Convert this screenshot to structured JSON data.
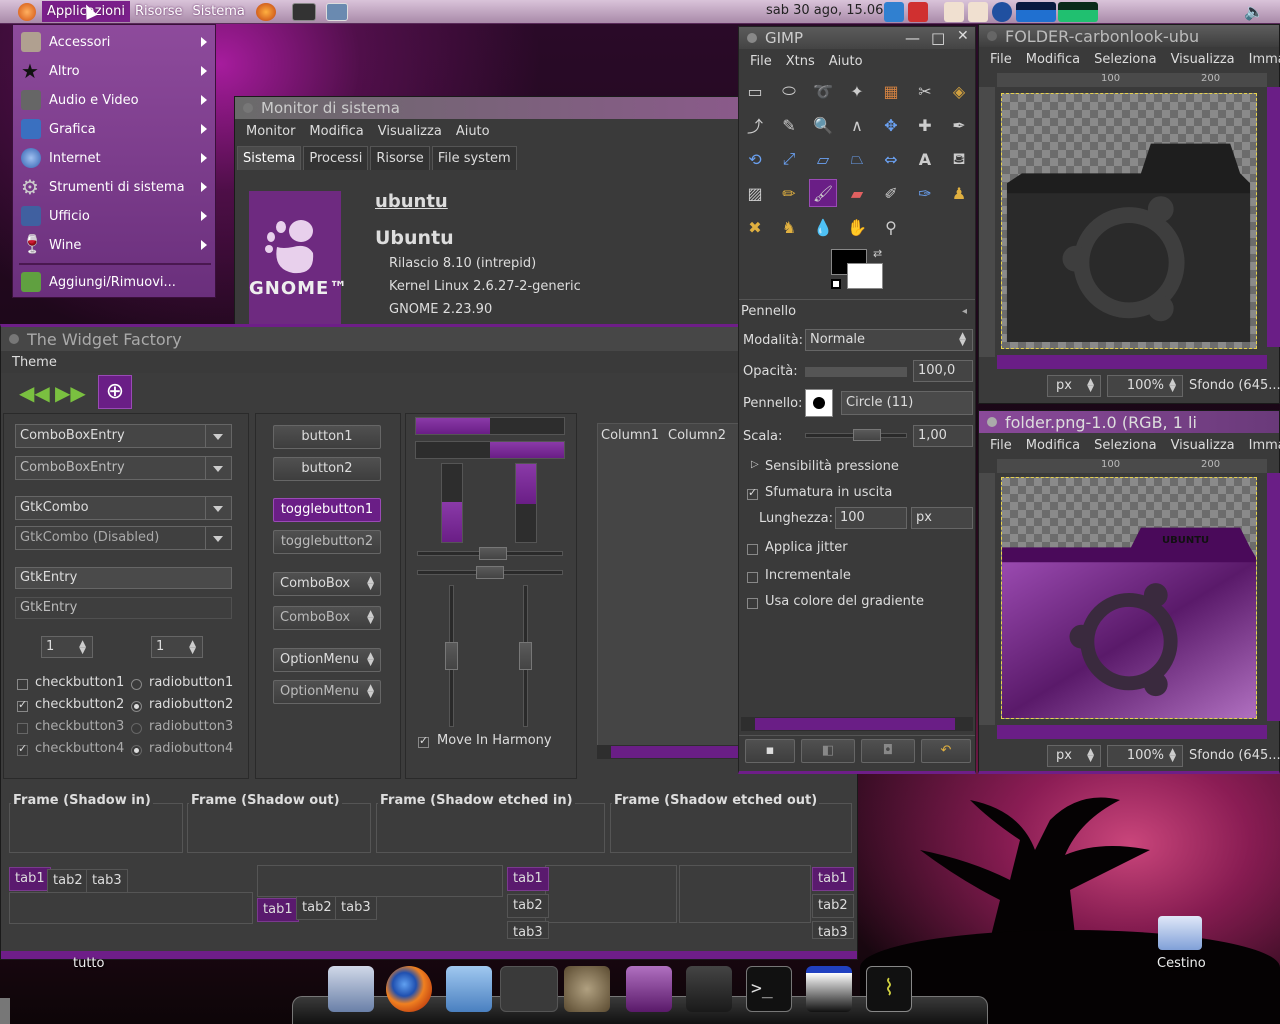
{
  "panel": {
    "menus": [
      "Applicazioni",
      "Risorse",
      "Sistema"
    ],
    "clock": "sab 30 ago, 15.06"
  },
  "app_menu": {
    "items": [
      {
        "label": "Accessori",
        "icon": "accessories-icon",
        "color": "#b0a090"
      },
      {
        "label": "Altro",
        "icon": "star-icon",
        "color": "#222222"
      },
      {
        "label": "Audio e Video",
        "icon": "film-icon",
        "color": "#666666"
      },
      {
        "label": "Grafica",
        "icon": "graphics-icon",
        "color": "#3a70c0"
      },
      {
        "label": "Internet",
        "icon": "globe-icon",
        "color": "#4a7ad0"
      },
      {
        "label": "Strumenti di sistema",
        "icon": "gear-icon",
        "color": "#888888"
      },
      {
        "label": "Ufficio",
        "icon": "office-icon",
        "color": "#4060a0"
      },
      {
        "label": "Wine",
        "icon": "wine-icon",
        "color": "#b03030"
      }
    ],
    "add_remove": "Aggiungi/Rimuovi..."
  },
  "sysmon": {
    "title": "Monitor di sistema",
    "menus": [
      "Monitor",
      "Modifica",
      "Visualizza",
      "Aiuto"
    ],
    "tabs": [
      "Sistema",
      "Processi",
      "Risorse",
      "File system"
    ],
    "hostname": "ubuntu",
    "distro": "Ubuntu",
    "release": "Rilascio 8.10 (intrepid)",
    "kernel": "Kernel Linux 2.6.27-2-generic",
    "gnome": "GNOME 2.23.90",
    "logo_text": "GNOME™"
  },
  "widget_factory": {
    "title": "The Widget Factory",
    "menu": "Theme",
    "combos": [
      "ComboBoxEntry",
      "ComboBoxEntry",
      "GtkCombo",
      "GtkCombo (Disabled)"
    ],
    "entries": [
      "GtkEntry",
      "GtkEntry"
    ],
    "spins": [
      "1",
      "1"
    ],
    "checks": [
      "checkbutton1",
      "checkbutton2",
      "checkbutton3",
      "checkbutton4"
    ],
    "radios": [
      "radiobutton1",
      "radiobutton2",
      "radiobutton3",
      "radiobutton4"
    ],
    "buttons": [
      "button1",
      "button2",
      "togglebutton1",
      "togglebutton2",
      "ComboBox",
      "ComboBox",
      "OptionMenu",
      "OptionMenu"
    ],
    "move_in_harmony": "Move In Harmony",
    "columns": [
      "Column1",
      "Column2"
    ],
    "frames": [
      "Frame (Shadow in)",
      "Frame (Shadow out)",
      "Frame (Shadow etched in)",
      "Frame (Shadow etched out)"
    ],
    "tabs": [
      "tab1",
      "tab2",
      "tab3"
    ],
    "progress": [
      0.5,
      0.5
    ],
    "accent": "#6a1e86"
  },
  "gimp": {
    "title": "GIMP",
    "menus": [
      "File",
      "Xtns",
      "Aiuto"
    ],
    "tool_options_title": "Pennello",
    "mode_label": "Modalità:",
    "mode_value": "Normale",
    "opacity_label": "Opacità:",
    "opacity_value": "100,0",
    "brush_label": "Pennello:",
    "brush_value": "Circle (11)",
    "scale_label": "Scala:",
    "scale_value": "1,00",
    "pressure": "Sensibilità pressione",
    "fade_out": "Sfumatura in uscita",
    "length_label": "Lunghezza:",
    "length_value": "100",
    "length_unit": "px",
    "jitter": "Applica jitter",
    "incremental": "Incrementale",
    "gradient_color": "Usa colore del gradiente"
  },
  "image_windows": [
    {
      "title": "FOLDER-carbonlook-ubu",
      "menus": [
        "File",
        "Modifica",
        "Seleziona",
        "Visualizza",
        "Immag"
      ],
      "ruler_marks": [
        "100",
        "200"
      ],
      "unit": "px",
      "zoom": "100%",
      "status": "Sfondo (645..."
    },
    {
      "title": "folder.png-1.0 (RGB, 1 li",
      "menus": [
        "File",
        "Modifica",
        "Seleziona",
        "Visualizza",
        "Immag"
      ],
      "ruler_marks": [
        "100",
        "200"
      ],
      "unit": "px",
      "zoom": "100%",
      "status": "Sfondo (645...",
      "folder_label": "UBUNTU"
    }
  ],
  "desktop": {
    "trash_label": "Cestino",
    "tutto_label": "tutto"
  }
}
